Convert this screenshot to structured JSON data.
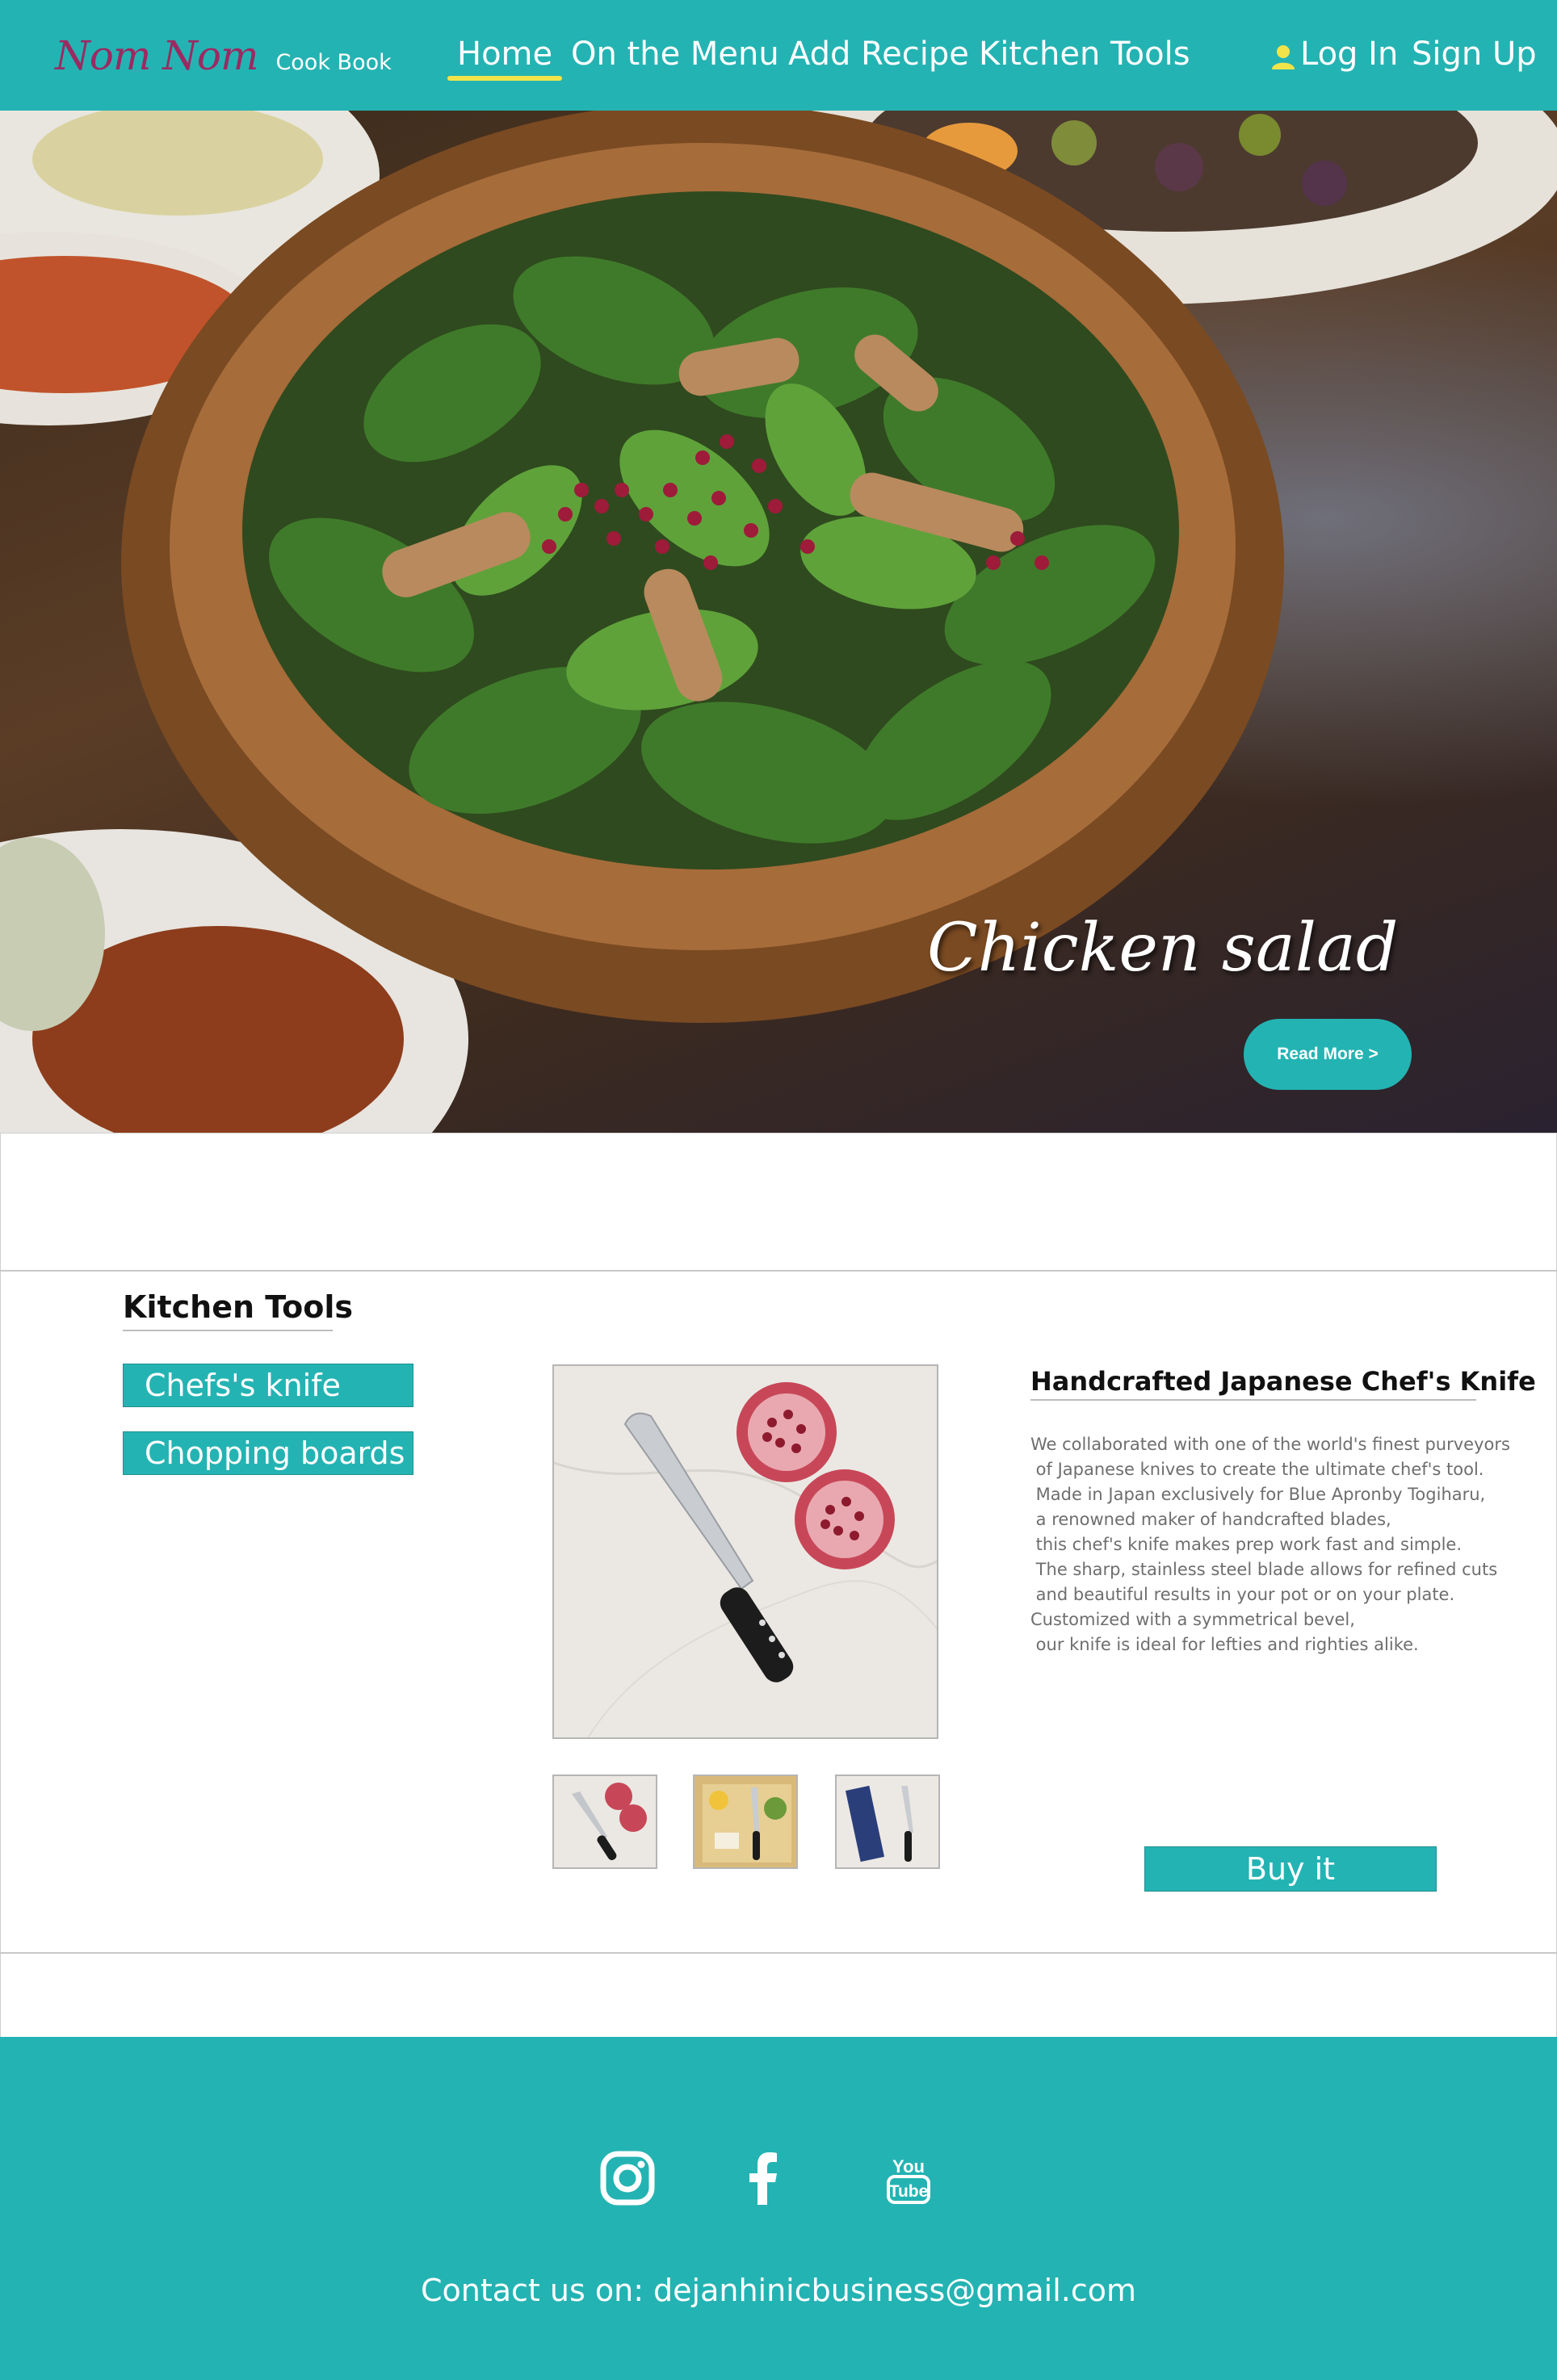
{
  "brand": {
    "name": "Nom Nom",
    "subtitle": "Cook Book",
    "color": "#9b2a62"
  },
  "accent_color": "#24b3b3",
  "nav": {
    "links": [
      "Home",
      "On the Menu",
      "Add Recipe",
      "Kitchen Tools"
    ],
    "active": "Home",
    "login": "Log In",
    "signup": "Sign Up",
    "login_icon": "user-icon"
  },
  "hero": {
    "title": "Chicken salad",
    "button": "Read More >"
  },
  "kitchen_tools": {
    "title": "Kitchen Tools",
    "categories": [
      "Chefs's knife",
      "Chopping boards"
    ],
    "product": {
      "title": "Handcrafted Japanese Chef's Knife",
      "description_lines": [
        "We collaborated with one of the world's finest purveyors",
        " of Japanese knives to create the ultimate chef's tool.",
        " Made in Japan exclusively for Blue Apronby Togiharu,",
        " a renowned maker of handcrafted blades,",
        " this chef's knife makes prep work fast and simple.",
        " The sharp, stainless steel blade allows for refined cuts",
        " and beautiful results in your pot or on your plate.",
        "Customized with a symmetrical bevel,",
        " our knife is ideal for lefties and righties alike."
      ],
      "buy_label": "Buy it"
    }
  },
  "footer": {
    "social_icons": [
      "instagram-icon",
      "facebook-icon",
      "youtube-icon"
    ],
    "contact_label": "Contact us on:",
    "email": "dejanhinicbusiness@gmail.com"
  }
}
